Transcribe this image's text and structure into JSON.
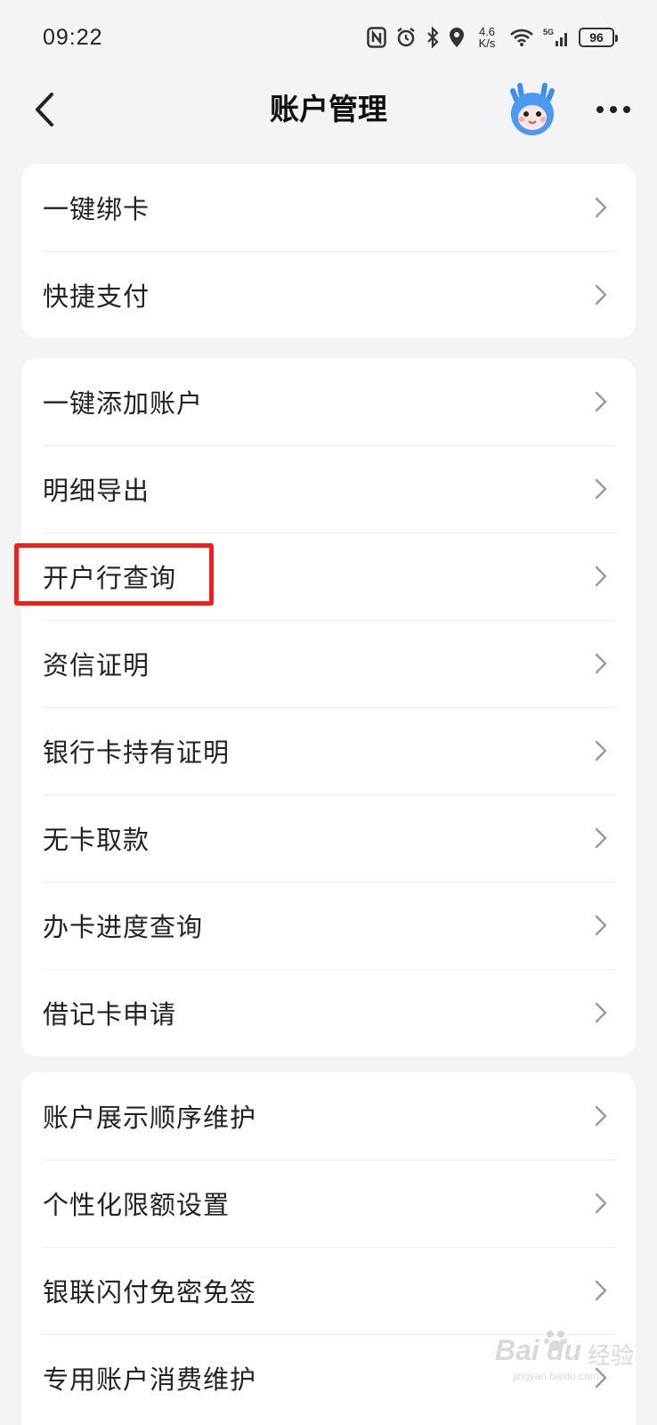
{
  "status": {
    "time": "09:22",
    "net_speed_top": "4.6",
    "net_speed_bottom": "K/s",
    "network": "5G",
    "battery": "96"
  },
  "nav": {
    "title": "账户管理",
    "back_icon": "chevron-left-icon",
    "more_icon": "more-icon"
  },
  "groups": [
    {
      "items": [
        {
          "label": "一键绑卡"
        },
        {
          "label": "快捷支付"
        }
      ]
    },
    {
      "items": [
        {
          "label": "一键添加账户"
        },
        {
          "label": "明细导出"
        },
        {
          "label": "开户行查询"
        },
        {
          "label": "资信证明"
        },
        {
          "label": "银行卡持有证明"
        },
        {
          "label": "无卡取款"
        },
        {
          "label": "办卡进度查询"
        },
        {
          "label": "借记卡申请"
        }
      ]
    },
    {
      "items": [
        {
          "label": "账户展示顺序维护"
        },
        {
          "label": "个性化限额设置"
        },
        {
          "label": "银联闪付免密免签"
        },
        {
          "label": "专用账户消费维护"
        }
      ]
    }
  ],
  "highlight": {
    "color": "#f0201c",
    "target": "开户行查询"
  },
  "watermark": {
    "brand": "Bai",
    "brand2": "du",
    "site_cn": "经验",
    "url": "jingyan.baidu.com"
  },
  "colors": {
    "background": "#f4f4f6",
    "card": "#ffffff",
    "text": "#222222",
    "chevron": "#999999"
  }
}
